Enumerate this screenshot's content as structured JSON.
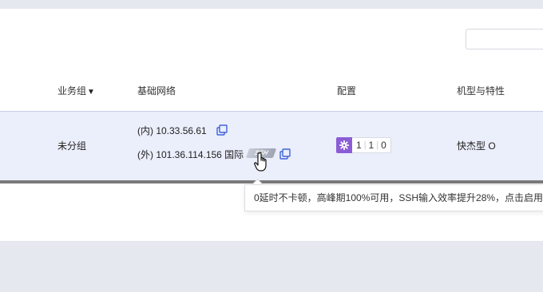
{
  "table": {
    "headers": {
      "group": "业务组",
      "group_sort_caret": "▼",
      "network": "基础网络",
      "config": "配置",
      "model": "机型与特性"
    },
    "row": {
      "group": "未分组",
      "ip_internal": "(内) 10.33.56.61",
      "ip_external": "(外) 101.36.114.156 国际",
      "ssh_badge": "SSH",
      "config_values": [
        "1",
        "1",
        "0"
      ],
      "model": "快杰型 O"
    }
  },
  "tooltip": {
    "text": "0延时不卡顿，高峰期100%可用，SSH输入效率提升28%，点击启用"
  },
  "colors": {
    "accent": "#3d63dd",
    "config_badge": "#8b5cd6",
    "row_highlight": "#ebeefb"
  },
  "icons": [
    "copy-icon",
    "copy-icon",
    "gear-icon",
    "hand-cursor-icon",
    "sort-caret-icon"
  ]
}
